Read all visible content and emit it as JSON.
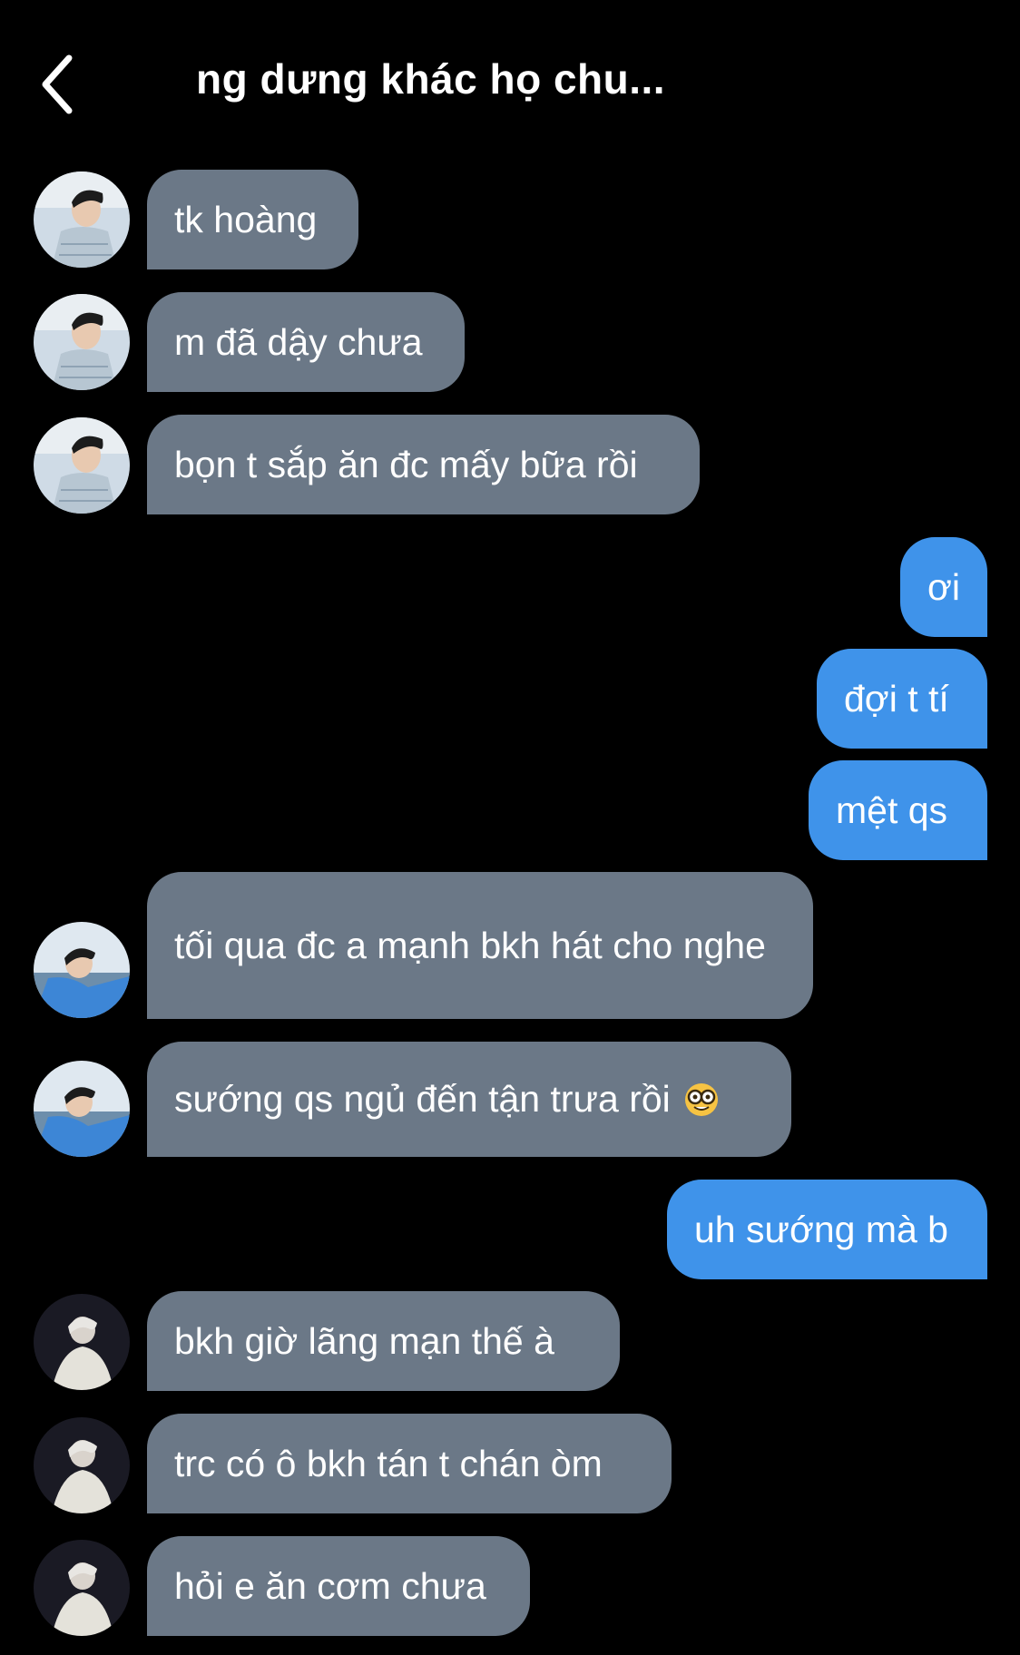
{
  "header": {
    "title": "ng dưng khác họ chu..."
  },
  "messages": [
    {
      "side": "in",
      "text": "tk hoàng",
      "avatar": "avatar-boy-shirt"
    },
    {
      "side": "in",
      "text": "m đã dậy chưa",
      "avatar": "avatar-boy-shirt"
    },
    {
      "side": "in",
      "text": "bọn t sắp ăn đc mấy bữa rồi",
      "avatar": "avatar-boy-shirt"
    },
    {
      "side": "out",
      "text": "ơi"
    },
    {
      "side": "out",
      "text": "đợi t tí"
    },
    {
      "side": "out",
      "text": "mệt qs"
    },
    {
      "side": "in",
      "text": "tối qua đc a mạnh bkh hát cho nghe",
      "avatar": "avatar-boy-blue-jacket"
    },
    {
      "side": "in",
      "text": "sướng qs ngủ đến tận trưa rồi",
      "emoji": "nerd-face-icon",
      "avatar": "avatar-boy-blue-jacket"
    },
    {
      "side": "out",
      "text": "uh sướng mà b"
    },
    {
      "side": "in",
      "text": "bkh giờ lãng mạn thế à",
      "avatar": "avatar-person-white-coat"
    },
    {
      "side": "in",
      "text": "trc có ô bkh tán t chán òm",
      "avatar": "avatar-person-white-coat"
    },
    {
      "side": "in",
      "text": "hỏi e ăn cơm chưa",
      "avatar": "avatar-person-white-coat"
    }
  ],
  "colors": {
    "background": "#000000",
    "incoming_bubble": "#6b7887",
    "outgoing_bubble": "#3f93ea",
    "text": "#ffffff"
  }
}
